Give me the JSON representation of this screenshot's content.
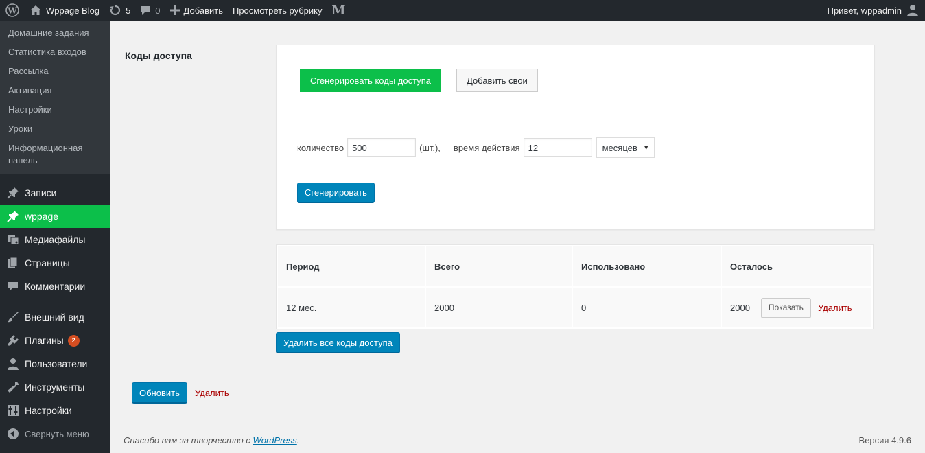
{
  "adminbar": {
    "site_name": "Wppage Blog",
    "updates_count": "5",
    "comments_count": "0",
    "add_label": "Добавить",
    "view_category_label": "Просмотреть рубрику",
    "m_logo": "M",
    "greeting": "Привет, wppadmin"
  },
  "submenu": [
    "Домашние задания",
    "Статистика входов",
    "Рассылка",
    "Активация",
    "Настройки",
    "Уроки",
    "Информационная панель"
  ],
  "menu": {
    "posts": "Записи",
    "wppage": "wppage",
    "media": "Медиафайлы",
    "pages": "Страницы",
    "comments": "Комментарии",
    "appearance": "Внешний вид",
    "plugins": "Плагины",
    "plugins_badge": "2",
    "users": "Пользователи",
    "tools": "Инструменты",
    "settings": "Настройки",
    "collapse": "Свернуть меню"
  },
  "section": {
    "label": "Коды доступа"
  },
  "generator": {
    "generate_codes_label": "Сгенерировать коды доступа",
    "add_own_label": "Добавить свои",
    "quantity_label": "количество",
    "quantity_value": "500",
    "quantity_unit": "(шт.),",
    "duration_label": "время действия",
    "duration_value": "12",
    "duration_unit_selected": "месяцев",
    "generate_label": "Сгенерировать"
  },
  "table": {
    "headers": [
      "Период",
      "Всего",
      "Использовано",
      "Осталось"
    ],
    "rows": [
      {
        "period": "12 мес.",
        "total": "2000",
        "used": "0",
        "left": "2000",
        "show_label": "Показать",
        "delete_label": "Удалить"
      }
    ],
    "delete_all_label": "Удалить все коды доступа"
  },
  "actions": {
    "update_label": "Обновить",
    "delete_label": "Удалить"
  },
  "footer": {
    "thanks_prefix": "Спасибо вам за творчество с ",
    "thanks_link": "WordPress",
    "thanks_suffix": ".",
    "version": "Версия 4.9.6"
  },
  "colors": {
    "accent_green": "#0cbf4a",
    "button_blue": "#0085ba",
    "sidebar": "#23282d",
    "delete_red": "#a00"
  },
  "icons": [
    "wordpress-icon",
    "home-icon",
    "updates-icon",
    "comments-icon",
    "plus-icon",
    "pin-icon",
    "media-icon",
    "pages-icon",
    "brush-icon",
    "plugin-icon",
    "users-icon",
    "tools-icon",
    "settings-icon",
    "collapse-icon",
    "user-icon"
  ]
}
